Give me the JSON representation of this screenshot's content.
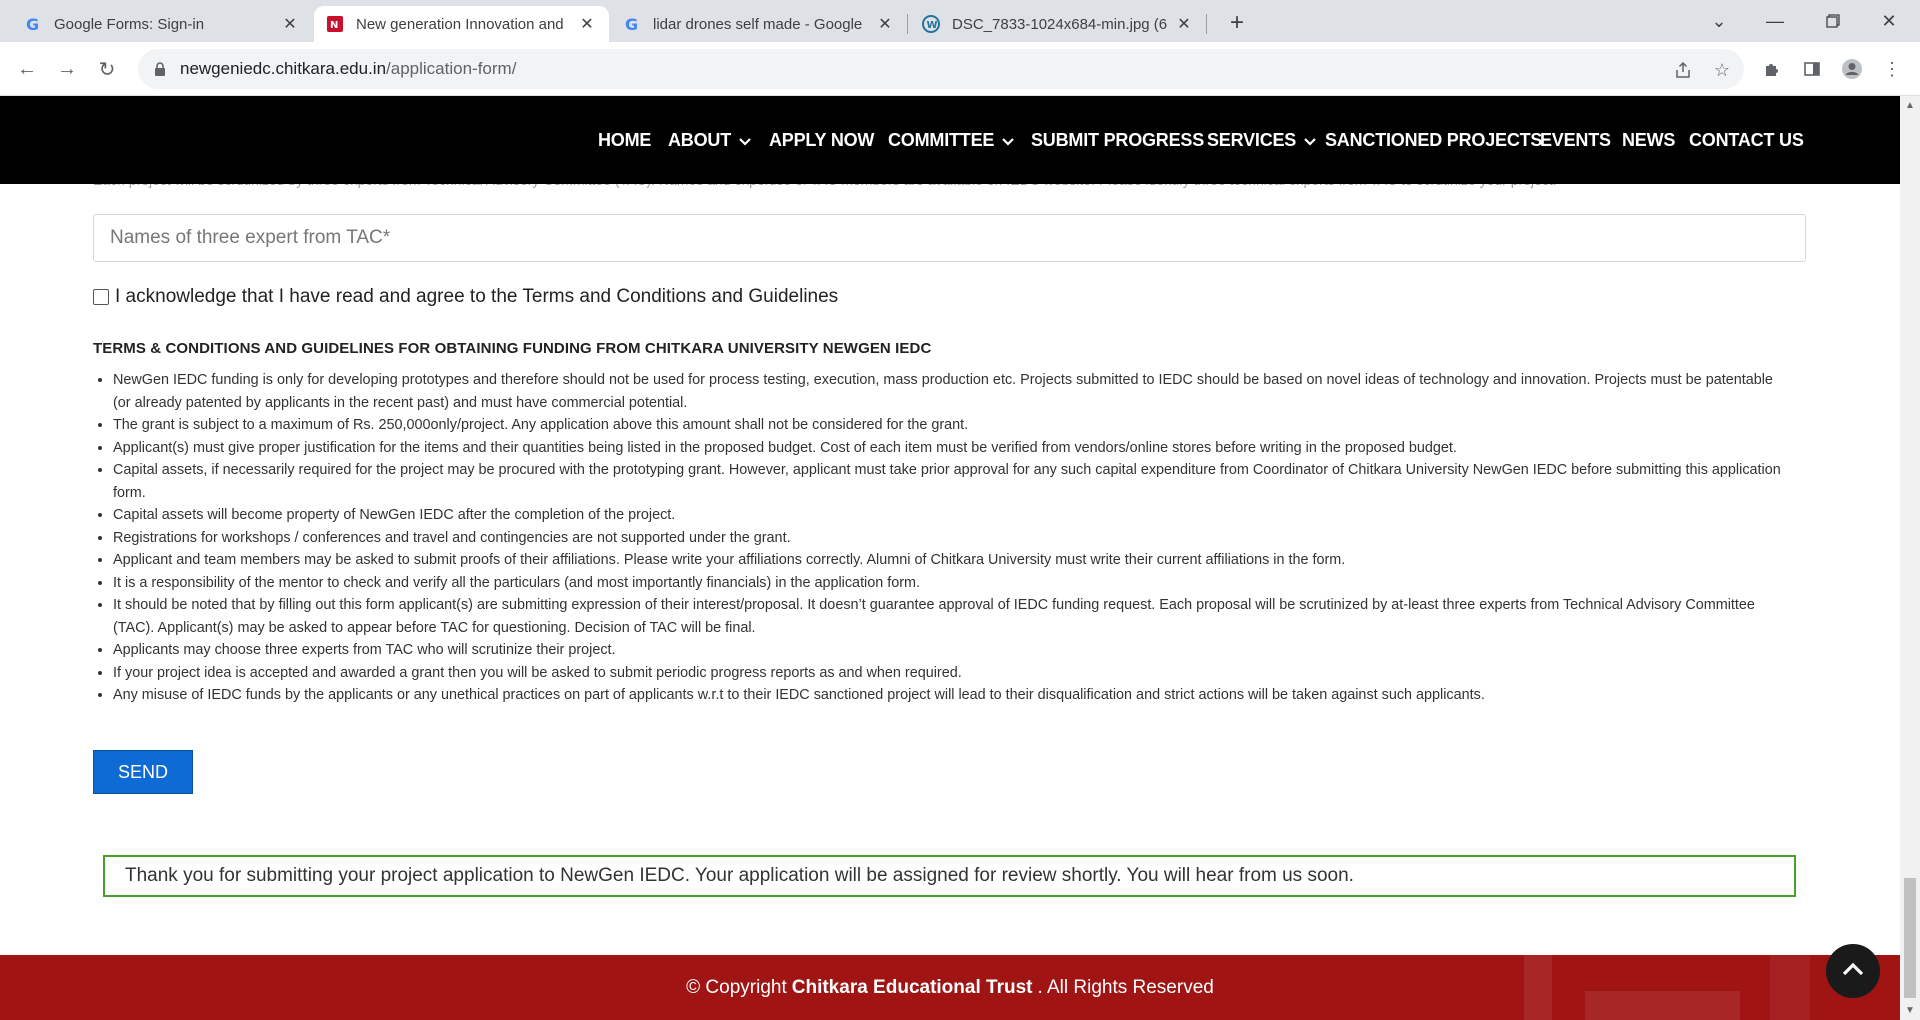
{
  "browser": {
    "tabs": [
      {
        "title": "Google Forms: Sign-in",
        "favicon": "google-icon"
      },
      {
        "title": "New generation Innovation and",
        "favicon": "newgen-icon"
      },
      {
        "title": "lidar drones self made - Google",
        "favicon": "google-icon"
      },
      {
        "title": "DSC_7833-1024x684-min.jpg (6",
        "favicon": "wordpress-icon"
      }
    ],
    "active_tab_index": 1,
    "url_host": "newgeniedc.chitkara.edu.in",
    "url_path": "/application-form/"
  },
  "nav": {
    "items": [
      "HOME",
      "ABOUT",
      "APPLY NOW",
      "COMMITTEE",
      "SUBMIT PROGRESS",
      "SERVICES",
      "SANCTIONED PROJECTS",
      "EVENTS",
      "NEWS",
      "CONTACT US"
    ]
  },
  "form": {
    "partial_text": "Each project will be scrutinized by three experts from Technical Advisory Committee (TAC). Names and expertise of TAC members are available on IEDC website. Please identify three technical experts from TAC to scrutinize your project.",
    "experts_placeholder": "Names of three expert from TAC*",
    "ack_label": "I acknowledge that I have read and agree to the Terms and Conditions and Guidelines",
    "ack_checked": false,
    "terms_title": "TERMS & CONDITIONS AND GUIDELINES FOR OBTAINING FUNDING FROM CHITKARA UNIVERSITY NEWGEN IEDC",
    "terms": [
      "NewGen IEDC funding is only for developing prototypes and therefore should not be used for process testing, execution, mass production etc. Projects submitted to IEDC should be based on novel ideas of technology and innovation. Projects must be patentable (or already patented by applicants in the recent past) and must have commercial potential.",
      "The grant is subject to a maximum of Rs. 250,000only/project. Any application above this amount shall not be considered for the grant.",
      "Applicant(s) must give proper justification for the items and their quantities being listed in the proposed budget. Cost of each item must be verified from vendors/online stores before writing in the proposed budget.",
      "Capital assets, if necessarily required for the project may be procured with the prototyping grant. However, applicant must take prior approval for any such capital expenditure from Coordinator of Chitkara University NewGen IEDC before submitting this application form.",
      "Capital assets will become property of NewGen IEDC after the completion of the project.",
      "Registrations for workshops / conferences and travel and contingencies are not supported under the grant.",
      "Applicant and team members may be asked to submit proofs of their affiliations. Please write your affiliations correctly. Alumni of Chitkara University must write their current affiliations in the form.",
      "It is a responsibility of the mentor to check and verify all the particulars (and most importantly financials) in the application form.",
      "It should be noted that by filling out this form applicant(s) are submitting expression of their interest/proposal. It doesn’t guarantee approval of IEDC funding request. Each proposal will be scrutinized by at-least three experts from Technical Advisory Committee (TAC). Applicant(s) may be asked to appear before TAC for questioning. Decision of TAC will be final.",
      "Applicants may choose three experts from TAC who will scrutinize their project.",
      "If your project idea is accepted and awarded a grant then you will be asked to submit periodic progress reports as and when required.",
      "Any misuse of IEDC funds by the applicants or any unethical practices on part of applicants w.r.t to their IEDC sanctioned project will lead to their disqualification and strict actions will be taken against such applicants."
    ],
    "send_label": "SEND",
    "success_message": "Thank you for submitting your project application to NewGen IEDC. Your application will be assigned for review shortly. You will hear from us soon."
  },
  "footer": {
    "prefix": "© Copyright",
    "org": "Chitkara Educational Trust",
    "suffix": ". All Rights Reserved"
  },
  "colors": {
    "nav_bg": "#000000",
    "send_button": "#0e6bd6",
    "success_border": "#46a12c",
    "footer_bg": "#a01414"
  }
}
